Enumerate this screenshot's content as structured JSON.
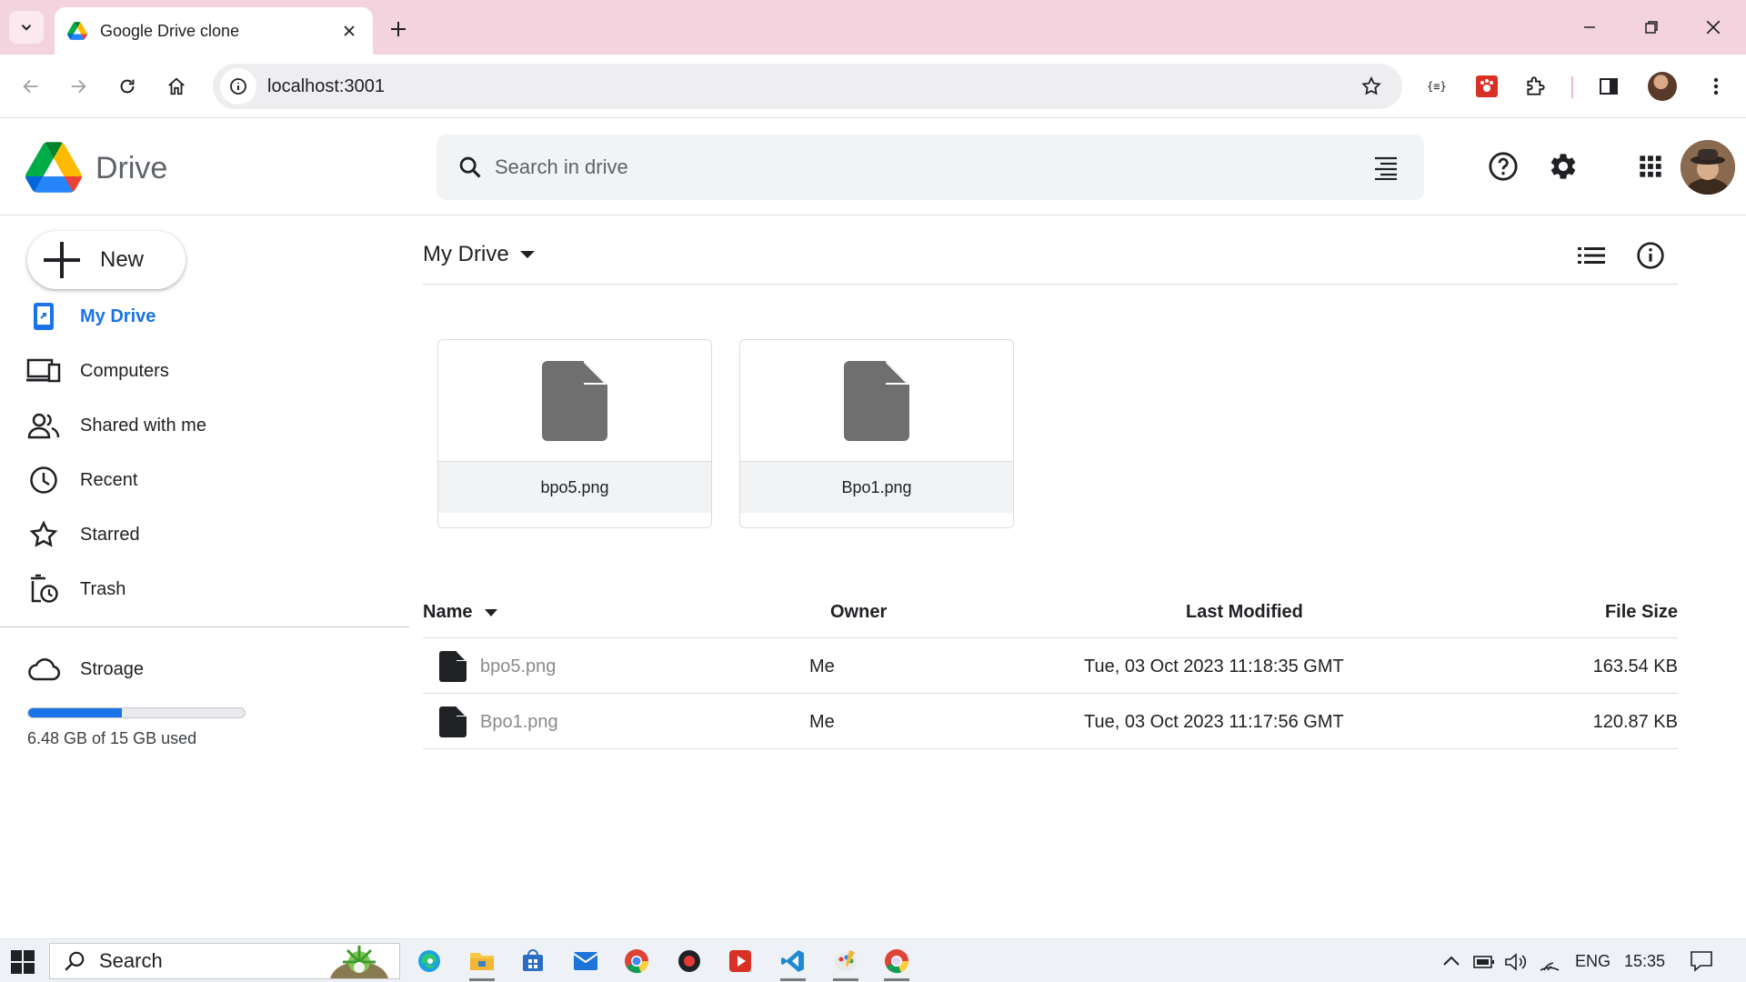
{
  "browser": {
    "tab_title": "Google Drive clone",
    "url": "localhost:3001"
  },
  "app": {
    "brand": "Drive",
    "search_placeholder": "Search in drive"
  },
  "sidebar": {
    "new_label": "New",
    "items": [
      {
        "label": "My Drive",
        "icon": "my-drive-icon",
        "active": true
      },
      {
        "label": "Computers",
        "icon": "computers-icon",
        "active": false
      },
      {
        "label": "Shared with me",
        "icon": "shared-icon",
        "active": false
      },
      {
        "label": "Recent",
        "icon": "clock-icon",
        "active": false
      },
      {
        "label": "Starred",
        "icon": "star-icon",
        "active": false
      },
      {
        "label": "Trash",
        "icon": "trash-icon",
        "active": false
      }
    ],
    "storage": {
      "label": "Stroage",
      "used_text": "6.48 GB of 15 GB used",
      "used_fraction": 0.432
    }
  },
  "main": {
    "breadcrumb": "My Drive",
    "suggested_files": [
      {
        "name": "bpo5.png"
      },
      {
        "name": "Bpo1.png"
      }
    ],
    "table": {
      "headers": {
        "name": "Name",
        "owner": "Owner",
        "modified": "Last Modified",
        "size": "File Size"
      },
      "rows": [
        {
          "name": "bpo5.png",
          "owner": "Me",
          "modified": "Tue, 03 Oct 2023 11:18:35 GMT",
          "size": "163.54 KB"
        },
        {
          "name": "Bpo1.png",
          "owner": "Me",
          "modified": "Tue, 03 Oct 2023 11:17:56 GMT",
          "size": "120.87 KB"
        }
      ]
    }
  },
  "taskbar": {
    "search_label": "Search",
    "language": "ENG",
    "time": "15:35"
  },
  "colors": {
    "accent": "#1a73e8",
    "tabstrip": "#f3d3de",
    "file_icon": "#6f6f6f"
  }
}
